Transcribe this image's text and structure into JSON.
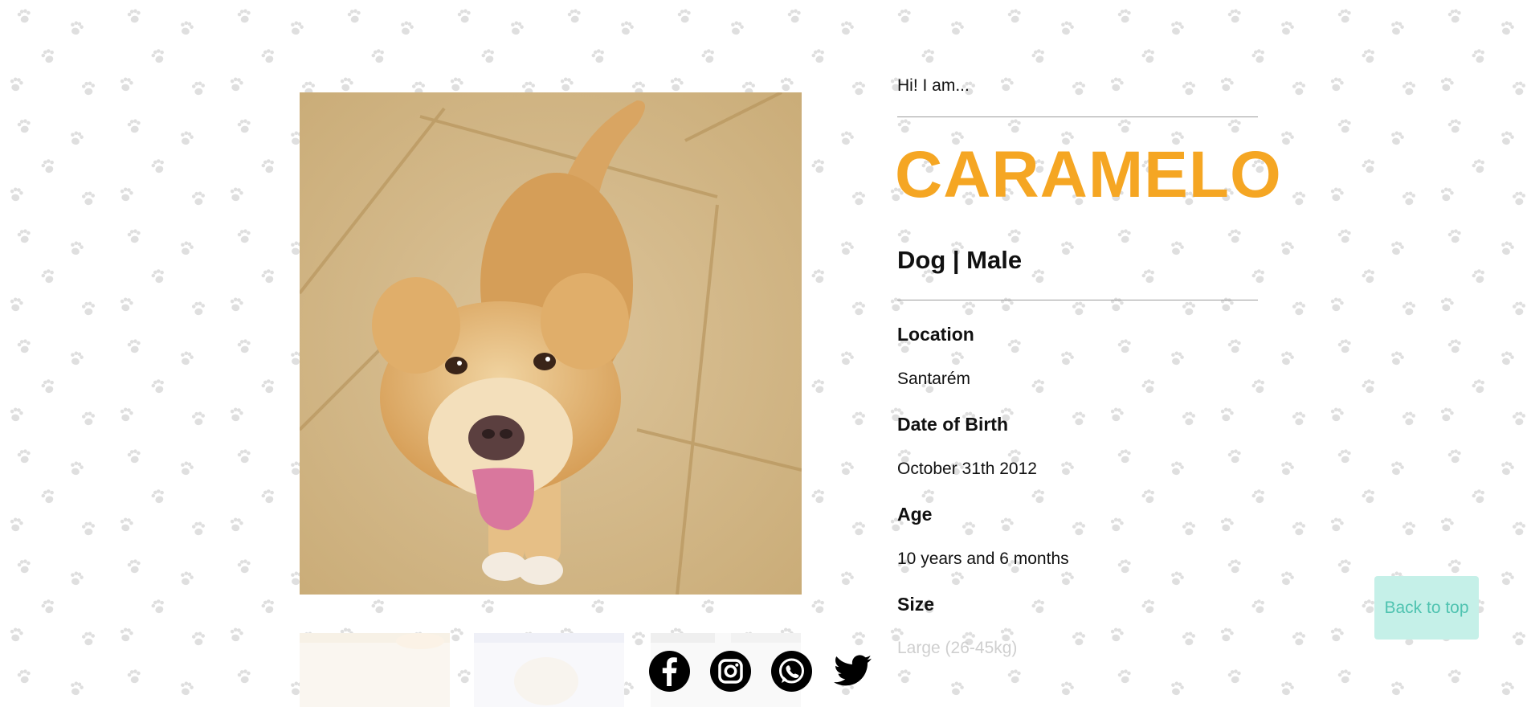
{
  "pet": {
    "intro": "Hi! I am...",
    "name": "CARAMELO",
    "species_sex": "Dog | Male"
  },
  "details": [
    {
      "label": "Location",
      "value": "Santarém"
    },
    {
      "label": "Date of Birth",
      "value": "October 31th 2012"
    },
    {
      "label": "Age",
      "value": "10 years and 6 months"
    },
    {
      "label": "Size",
      "value": "Large (26-45kg)"
    }
  ],
  "share": {
    "icons": [
      "facebook-icon",
      "instagram-icon",
      "whatsapp-icon",
      "twitter-icon"
    ]
  },
  "back_to_top": "Back to top",
  "colors": {
    "accent": "#f5a623",
    "back_to_top_bg": "#c5f0e8",
    "back_to_top_text": "#4fc3b0",
    "paw_pattern": "#d4d4d4"
  }
}
